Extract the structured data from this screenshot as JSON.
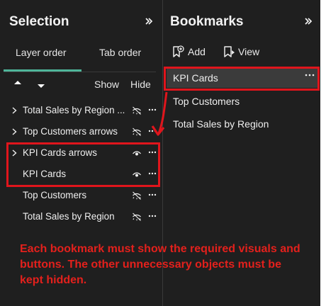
{
  "selection_panel": {
    "title": "Selection",
    "tabs": [
      "Layer order",
      "Tab order"
    ],
    "active_tab": "Layer order",
    "show_label": "Show",
    "hide_label": "Hide",
    "layers": [
      {
        "label": "Total Sales by Region ...",
        "expandable": true,
        "visible": false
      },
      {
        "label": "Top Customers arrows",
        "expandable": true,
        "visible": false
      },
      {
        "label": "KPI Cards arrows",
        "expandable": true,
        "visible": true
      },
      {
        "label": "KPI Cards",
        "expandable": false,
        "visible": true
      },
      {
        "label": "Top Customers",
        "expandable": false,
        "visible": false
      },
      {
        "label": "Total Sales by Region",
        "expandable": false,
        "visible": false
      }
    ]
  },
  "bookmarks_panel": {
    "title": "Bookmarks",
    "add_label": "Add",
    "view_label": "View",
    "bookmarks": [
      {
        "label": "KPI Cards",
        "selected": true
      },
      {
        "label": "Top Customers",
        "selected": false
      },
      {
        "label": "Total Sales by Region",
        "selected": false
      }
    ]
  },
  "annotation": {
    "text": "Each bookmark must show the required visuals and buttons. The other unnecessary objects must be kept hidden.",
    "color": "#e3201c"
  },
  "colors": {
    "background": "#1f1f1f",
    "text": "#efefef",
    "accent": "#4fb59a",
    "selected_row": "#3b3b3b",
    "callout": "#e0151c"
  },
  "icons": {
    "collapse": "chevron-double-right-icon",
    "expand": "chevron-right-icon",
    "visible": "eye-icon",
    "hidden": "eye-off-icon",
    "more": "more-options-icon",
    "add": "bookmark-add-icon",
    "view": "bookmark-view-icon",
    "sort_up": "move-up-icon",
    "sort_down": "move-down-icon"
  }
}
